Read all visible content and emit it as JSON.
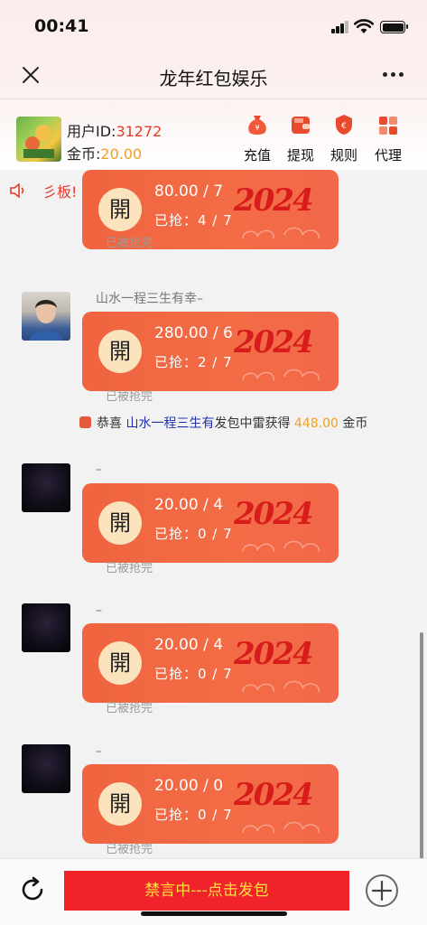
{
  "status_bar": {
    "time": "00:41"
  },
  "header": {
    "title": "龙年红包娱乐",
    "close_icon": "close-icon",
    "more_icon": "more-icon"
  },
  "user": {
    "id_label": "用户ID:",
    "id_value": "31272",
    "coin_label": "金币:",
    "coin_value": "20.00"
  },
  "actions": [
    {
      "label": "充值",
      "icon": "money-bag-icon"
    },
    {
      "label": "提现",
      "icon": "wallet-icon"
    },
    {
      "label": "规则",
      "icon": "shield-icon"
    },
    {
      "label": "代理",
      "icon": "agent-icon"
    }
  ],
  "marquee": {
    "text": "彡板!"
  },
  "packet_open_label": "開",
  "packet_year": "2024",
  "messages": [
    {
      "name": "",
      "amount": "80.00 / 7",
      "grabbed": "已抢：4 / 7",
      "status": "已被抢完"
    },
    {
      "name": "山水一程三生有幸–",
      "amount": "280.00 / 6",
      "grabbed": "已抢：2 / 7",
      "status": "已被抢完"
    },
    {
      "name": "–",
      "amount": "20.00 / 4",
      "grabbed": "已抢：0 / 7",
      "status": "已被抢完"
    },
    {
      "name": "–",
      "amount": "20.00 / 4",
      "grabbed": "已抢：0 / 7",
      "status": "已被抢完"
    },
    {
      "name": "–",
      "amount": "20.00 / 0",
      "grabbed": "已抢：0 / 7",
      "status": "已被抢完"
    }
  ],
  "notice": {
    "prefix": "恭喜",
    "who": "山水一程三生有",
    "mid": "发包中雷获得",
    "amount": "448.00",
    "suffix": "金币"
  },
  "bottom": {
    "send_label": "禁言中---点击发包"
  },
  "colors": {
    "accent_red": "#e23b2a",
    "gold": "#f0a020",
    "packet": "#f06440",
    "send_bg": "#f0222a",
    "send_text": "#ffe040"
  }
}
